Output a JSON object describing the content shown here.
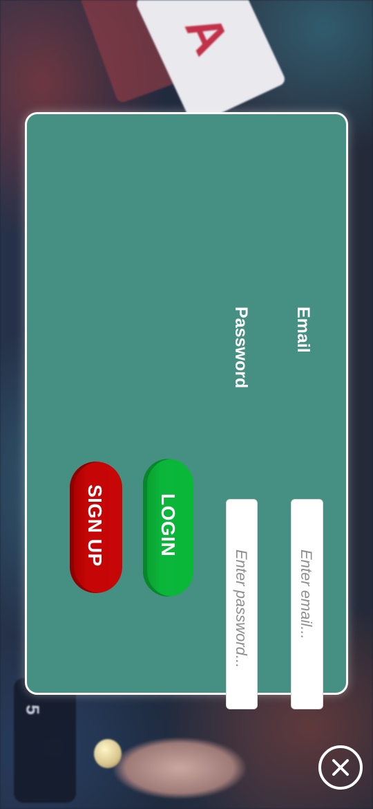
{
  "login_modal": {
    "email_label": "Email",
    "email_placeholder": "Enter email...",
    "password_label": "Password",
    "password_placeholder": "Enter password...",
    "login_button": "LOGIN",
    "signup_button": "SIGN UP",
    "close_icon": "close-icon"
  },
  "background": {
    "chip_number": "5"
  },
  "colors": {
    "modal_background": "#458f83",
    "login_button": "#0bb53a",
    "signup_button": "#c60606",
    "border": "#ffffff"
  }
}
